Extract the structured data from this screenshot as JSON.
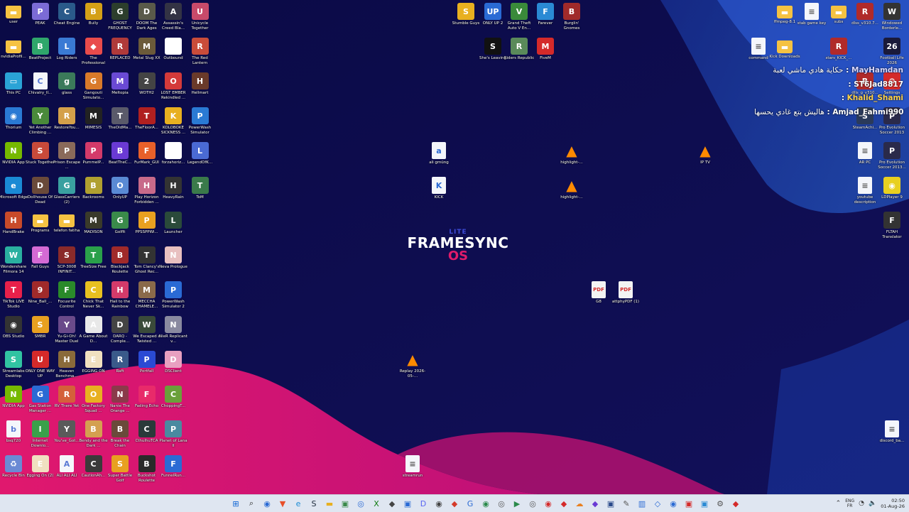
{
  "desktop": {
    "left_icons": [
      {
        "label": "user",
        "glyph": "▬",
        "color": "#f5c242",
        "kind": "folder"
      },
      {
        "label": "PEAK",
        "glyph": "P",
        "color": "#7b6bd6"
      },
      {
        "label": "Cheat Engine",
        "glyph": "C",
        "color": "#2a5a8a"
      },
      {
        "label": "Bully",
        "glyph": "B",
        "color": "#d4a017"
      },
      {
        "label": "GHOST FREQUENCY",
        "glyph": "G",
        "color": "#2c3e2c"
      },
      {
        "label": "DOOM The Dark Ages",
        "glyph": "D",
        "color": "#5a5a4a"
      },
      {
        "label": "Assassin's Creed Bla...",
        "glyph": "A",
        "color": "#333344"
      },
      {
        "label": "Unicycle Together",
        "glyph": "U",
        "color": "#c84a6a"
      },
      {
        "label": "nvidiaProfil...",
        "glyph": "▬",
        "color": "#f5c242",
        "kind": "folder"
      },
      {
        "label": "BeatProject",
        "glyph": "B",
        "color": "#2fa66b"
      },
      {
        "label": "Log Riders",
        "glyph": "L",
        "color": "#3a7ad4"
      },
      {
        "label": "The Professional",
        "glyph": "◆",
        "color": "#e94b4b"
      },
      {
        "label": "REPLACED",
        "glyph": "R",
        "color": "#b03a3a"
      },
      {
        "label": "Metal Slug XX",
        "glyph": "M",
        "color": "#6b5a3a"
      },
      {
        "label": "Outbound",
        "glyph": "O",
        "color": "#ffffff"
      },
      {
        "label": "The Red Lantern",
        "glyph": "R",
        "color": "#c94c3a"
      },
      {
        "label": "This PC",
        "glyph": "▭",
        "color": "#2aa3d6"
      },
      {
        "label": "Chivalry_II...",
        "glyph": "C",
        "color": "#5a7ad4",
        "kind": "doc"
      },
      {
        "label": "glass",
        "glyph": "g",
        "color": "#3b7a5a"
      },
      {
        "label": "Gangouti Simulato...",
        "glyph": "G",
        "color": "#d97a2a"
      },
      {
        "label": "Meltopia",
        "glyph": "M",
        "color": "#6a4ad4"
      },
      {
        "label": "WOTH2",
        "glyph": "2",
        "color": "#444"
      },
      {
        "label": "LOST EMBER Rekindled ...",
        "glyph": "O",
        "color": "#d43a3a"
      },
      {
        "label": "Hellmart",
        "glyph": "H",
        "color": "#6a3a2a"
      },
      {
        "label": "Thorium",
        "glyph": "◉",
        "color": "#2a7ad4"
      },
      {
        "label": "Yet Another Climbing ...",
        "glyph": "Y",
        "color": "#4a8a3a"
      },
      {
        "label": "RestoreYou...",
        "glyph": "R",
        "color": "#d4a04a"
      },
      {
        "label": "MIMESIS",
        "glyph": "M",
        "color": "#222"
      },
      {
        "label": "TheOldMa...",
        "glyph": "T",
        "color": "#5a5a6a"
      },
      {
        "label": "TheFloorA...",
        "glyph": "T",
        "color": "#b02020"
      },
      {
        "label": "KOLOBOKE SICKNESS ...",
        "glyph": "K",
        "color": "#e8b020"
      },
      {
        "label": "PowerWash Simulator",
        "glyph": "P",
        "color": "#2a7ad4"
      },
      {
        "label": "NVIDIA App",
        "glyph": "N",
        "color": "#76b900"
      },
      {
        "label": "Stuck Together",
        "glyph": "S",
        "color": "#c84a3a"
      },
      {
        "label": "Prison Escape ...",
        "glyph": "P",
        "color": "#8a6a5a"
      },
      {
        "label": "PummelP...",
        "glyph": "P",
        "color": "#d43a6a"
      },
      {
        "label": "BeatTheC...",
        "glyph": "B",
        "color": "#6a3ad4"
      },
      {
        "label": "FurMark_GUI",
        "glyph": "F",
        "color": "#e8602a"
      },
      {
        "label": "forzahoriz...",
        "glyph": "F",
        "color": "#ffffff"
      },
      {
        "label": "LegendOfK...",
        "glyph": "L",
        "color": "#4a6ad4"
      },
      {
        "label": "Microsoft Edge",
        "glyph": "e",
        "color": "#1a8ad4"
      },
      {
        "label": "Dollhouse Of Dead",
        "glyph": "D",
        "color": "#6a4a3a"
      },
      {
        "label": "GlassCarriers (2)",
        "glyph": "G",
        "color": "#3aa0a0"
      },
      {
        "label": "Backrooms",
        "glyph": "B",
        "color": "#b0a030"
      },
      {
        "label": "OnlyUP",
        "glyph": "O",
        "color": "#5a8ad4"
      },
      {
        "label": "Play Horizon Forbidden ...",
        "glyph": "H",
        "color": "#c86a8a"
      },
      {
        "label": "HeavyRain",
        "glyph": "H",
        "color": "#333"
      },
      {
        "label": "ToM",
        "glyph": "T",
        "color": "#3a7a4a"
      },
      {
        "label": "HandBrake",
        "glyph": "H",
        "color": "#c84a2a"
      },
      {
        "label": "Programs",
        "glyph": "▬",
        "color": "#f5c242",
        "kind": "folder"
      },
      {
        "label": "telefon fatiha",
        "glyph": "▬",
        "color": "#f5c242",
        "kind": "folder"
      },
      {
        "label": "MADISON",
        "glyph": "M",
        "color": "#3a3a2a"
      },
      {
        "label": "GolfIt",
        "glyph": "G",
        "color": "#3a8a4a"
      },
      {
        "label": "PPSSPPWi...",
        "glyph": "P",
        "color": "#e8a020"
      },
      {
        "label": "Launcher",
        "glyph": "L",
        "color": "#2a4a3a"
      },
      {
        "label": "Wondershare Filmora 14",
        "glyph": "W",
        "color": "#2ab0a0"
      },
      {
        "label": "Fall Guys",
        "glyph": "F",
        "color": "#d46ad4"
      },
      {
        "label": "SCP-3008 INFINIT...",
        "glyph": "S",
        "color": "#8a2a2a"
      },
      {
        "label": "TreeSize Free",
        "glyph": "T",
        "color": "#2aa04a"
      },
      {
        "label": "Blackjack Roulette",
        "glyph": "B",
        "color": "#a02a2a"
      },
      {
        "label": "Tom Clancy's Ghost Rec...",
        "glyph": "T",
        "color": "#333"
      },
      {
        "label": "Neva Prologue",
        "glyph": "N",
        "color": "#e8c0c0"
      },
      {
        "label": "TikTok LIVE Studio",
        "glyph": "T",
        "color": "#e8204a"
      },
      {
        "label": "Nine_Ball_...",
        "glyph": "9",
        "color": "#a02a2a"
      },
      {
        "label": "Focusrite Control",
        "glyph": "F",
        "color": "#2a8a2a"
      },
      {
        "label": "Chick That Never Sk...",
        "glyph": "C",
        "color": "#e8c020"
      },
      {
        "label": "Hail to the Rainbow",
        "glyph": "H",
        "color": "#d43a6a"
      },
      {
        "label": "MECCHA CHAMELE...",
        "glyph": "M",
        "color": "#8a6a4a"
      },
      {
        "label": "PowerWash Simulator 2",
        "glyph": "P",
        "color": "#2a6ad4"
      },
      {
        "label": "OBS Studio",
        "glyph": "◉",
        "color": "#333"
      },
      {
        "label": "SMBR",
        "glyph": "S",
        "color": "#e8a020"
      },
      {
        "label": "Yu-Gi-Oh! Master Duel",
        "glyph": "Y",
        "color": "#6a4a8a"
      },
      {
        "label": "A Game About D...",
        "glyph": "A",
        "color": "#e8e8e8"
      },
      {
        "label": "DARQ - Comple...",
        "glyph": "D",
        "color": "#444"
      },
      {
        "label": "We Escaped a Twisted ...",
        "glyph": "W",
        "color": "#3a4a3a"
      },
      {
        "label": "NieR Replicant v...",
        "glyph": "N",
        "color": "#8a8aa0"
      },
      {
        "label": "Streamlabs Desktop",
        "glyph": "S",
        "color": "#31c3a2"
      },
      {
        "label": "ONLY ONE WAY UP",
        "glyph": "U",
        "color": "#d42a2a"
      },
      {
        "label": "Heaven Benchma...",
        "glyph": "H",
        "color": "#8a6a3a"
      },
      {
        "label": "EGGING ON",
        "glyph": "E",
        "color": "#f0e0c0"
      },
      {
        "label": "Raft",
        "glyph": "R",
        "color": "#3a5a8a"
      },
      {
        "label": "Portfall",
        "glyph": "P",
        "color": "#2a4ad4"
      },
      {
        "label": "DSClient",
        "glyph": "D",
        "color": "#e8a0c0"
      },
      {
        "label": "NVIDIA App",
        "glyph": "N",
        "color": "#76b900"
      },
      {
        "label": "Gas Station Manager ...",
        "glyph": "G",
        "color": "#2a6ad4"
      },
      {
        "label": "RV There Yet",
        "glyph": "R",
        "color": "#d4603a"
      },
      {
        "label": "One Factory Squad ...",
        "glyph": "O",
        "color": "#e8b020"
      },
      {
        "label": "Nanie The Orange ...",
        "glyph": "N",
        "color": "#8a3a4a"
      },
      {
        "label": "Fading Echo",
        "glyph": "F",
        "color": "#e82a6a"
      },
      {
        "label": "ChoppingT...",
        "glyph": "C",
        "color": "#6aa03a"
      },
      {
        "label": "bsq720",
        "glyph": "b",
        "color": "#5a7ad4",
        "kind": "doc"
      },
      {
        "label": "Internet Downlo...",
        "glyph": "I",
        "color": "#3aa04a"
      },
      {
        "label": "You've_Got...",
        "glyph": "Y",
        "color": "#5a5a5a"
      },
      {
        "label": "Bendy and the Dark ...",
        "glyph": "B",
        "color": "#d4a050"
      },
      {
        "label": "Break the Chain",
        "glyph": "B",
        "color": "#6a4a3a"
      },
      {
        "label": "CthulhuTCA",
        "glyph": "C",
        "color": "#2a3a3a"
      },
      {
        "label": "Planet of Lana II",
        "glyph": "P",
        "color": "#4a8aa0"
      },
      {
        "label": "Recycle Bin",
        "glyph": "♻",
        "color": "#6a8ad4"
      },
      {
        "label": "Egging On (2)",
        "glyph": "E",
        "color": "#f0e0c0"
      },
      {
        "label": "ALI ALI ALI",
        "glyph": "A",
        "color": "#5a7ad4",
        "kind": "doc"
      },
      {
        "label": "CautionAh...",
        "glyph": "C",
        "color": "#3a3a3a"
      },
      {
        "label": "Super Battle Golf",
        "glyph": "S",
        "color": "#e8a020"
      },
      {
        "label": "Buckshot Roulette",
        "glyph": "B",
        "color": "#2a2a2a"
      },
      {
        "label": "FunnelRun...",
        "glyph": "F",
        "color": "#2a6ad4"
      }
    ],
    "middle_icons": [
      {
        "label": "Stumble Guys",
        "glyph": "S",
        "color": "#e8b020"
      },
      {
        "label": "ONLY UP 2",
        "glyph": "UP",
        "color": "#2a6ad4"
      },
      {
        "label": "Grand Theft Auto V En...",
        "glyph": "V",
        "color": "#3a8a3a"
      },
      {
        "label": "Farever",
        "glyph": "F",
        "color": "#2a8ad4"
      },
      {
        "label": "Burglin' Gnomes",
        "glyph": "B",
        "color": "#a02a2a"
      },
      {
        "label": "She's Leaving",
        "glyph": "S",
        "color": "#111"
      },
      {
        "label": "Riders Republic",
        "glyph": "R",
        "color": "#5a8a5a"
      },
      {
        "label": "FiveM",
        "glyph": "M",
        "color": "#d42a2a"
      },
      {
        "label": "ali gmüng",
        "glyph": "a",
        "color": "#2a6ad4",
        "kind": "doc"
      },
      {
        "label": "highlight-...",
        "glyph": "▲",
        "color": "#ff8a00",
        "kind": "cone"
      },
      {
        "label": "IP TV",
        "glyph": "▲",
        "color": "#ff8a00",
        "kind": "cone"
      },
      {
        "label": "KICK",
        "glyph": "K",
        "color": "#2a6ad4",
        "kind": "doc"
      },
      {
        "label": "highlight-...",
        "glyph": "▲",
        "color": "#ff8a00",
        "kind": "cone"
      },
      {
        "label": "G8",
        "glyph": "PDF",
        "color": "#d42a2a",
        "kind": "pdf"
      },
      {
        "label": "attphyPDF (1)",
        "glyph": "PDF",
        "color": "#d42a2a",
        "kind": "pdf"
      },
      {
        "label": "Replay 2026-05-...",
        "glyph": "▲",
        "color": "#ff8a00",
        "kind": "cone"
      },
      {
        "label": "streamrun",
        "glyph": "≡",
        "color": "#555",
        "kind": "doc"
      }
    ],
    "right_icons": [
      {
        "label": "ffmpeg-8.1",
        "glyph": "▬",
        "color": "#f5c242",
        "kind": "folder"
      },
      {
        "label": "stab game key",
        "glyph": "≡",
        "color": "#555",
        "kind": "doc"
      },
      {
        "label": "subs",
        "glyph": "▬",
        "color": "#f5c242",
        "kind": "folder"
      },
      {
        "label": "dlss_v310.7...",
        "glyph": "R",
        "color": "#b02a2a"
      },
      {
        "label": "Windowed Borderle...",
        "glyph": "W",
        "color": "#333"
      },
      {
        "label": "command",
        "glyph": "≡",
        "color": "#555",
        "kind": "doc"
      },
      {
        "label": "Kick Downloads",
        "glyph": "▬",
        "color": "#f5c242",
        "kind": "folder"
      },
      {
        "label": "stars_KICK_...",
        "glyph": "R",
        "color": "#b02a2a"
      },
      {
        "label": "Football Life 2026",
        "glyph": "26",
        "color": "#1a1a3a"
      },
      {
        "label": "dlls_g_v310...",
        "glyph": "R",
        "color": "#b02a2a"
      },
      {
        "label": "Settings",
        "glyph": "⚙",
        "color": "#d42a2a"
      },
      {
        "label": "SteamAchi...",
        "glyph": "S",
        "color": "#2a3a5a"
      },
      {
        "label": "Pro Evolution Soccer 2013",
        "glyph": "P",
        "color": "#2a2a4a"
      },
      {
        "label": "AR PC",
        "glyph": "≡",
        "color": "#555",
        "kind": "doc"
      },
      {
        "label": "Pro Evolution Soccer 2013...",
        "glyph": "P",
        "color": "#2a2a4a"
      },
      {
        "label": "youtube description",
        "glyph": "≡",
        "color": "#555",
        "kind": "doc"
      },
      {
        "label": "LDPlayer 9",
        "glyph": "◉",
        "color": "#e8d020"
      },
      {
        "label": "FLTAH Translator",
        "glyph": "F",
        "color": "#333"
      },
      {
        "label": "discord_ba...",
        "glyph": "≡",
        "color": "#555",
        "kind": "doc"
      }
    ],
    "logo": {
      "lite": "LITE",
      "name": "FRAMESYNC",
      "os": "OS"
    },
    "chat": [
      {
        "user": "MayHamdan",
        "message": "حكاية هادي ماشي لعبة",
        "user_color": "#d8d8ff"
      },
      {
        "user": "ST6Jad8817",
        "message": "",
        "user_color": "#ffffff"
      },
      {
        "user": "Khalid_Shami",
        "message": "",
        "user_color": "#ffd24a"
      },
      {
        "user": "Amjad_Fahmi990",
        "message": "هاليش بتع غادي يحسها",
        "user_color": "#ffffff"
      }
    ]
  },
  "taskbar": {
    "apps": [
      {
        "name": "start-icon",
        "glyph": "⊞",
        "color": "#0a62d4"
      },
      {
        "name": "search-icon",
        "glyph": "⌕",
        "color": "#222"
      },
      {
        "name": "thorium-icon",
        "glyph": "◉",
        "color": "#2a6ad4"
      },
      {
        "name": "brave-icon",
        "glyph": "▼",
        "color": "#e8502a"
      },
      {
        "name": "edge-icon",
        "glyph": "e",
        "color": "#1a8ad4"
      },
      {
        "name": "steam-icon",
        "glyph": "S",
        "color": "#1b2838"
      },
      {
        "name": "explorer-icon",
        "glyph": "▬",
        "color": "#e8b020"
      },
      {
        "name": "app-icon",
        "glyph": "▣",
        "color": "#3a8a4a"
      },
      {
        "name": "app-icon",
        "glyph": "◎",
        "color": "#2a6ad4"
      },
      {
        "name": "xbox-icon",
        "glyph": "X",
        "color": "#107c10"
      },
      {
        "name": "app-icon",
        "glyph": "◆",
        "color": "#444"
      },
      {
        "name": "app-icon",
        "glyph": "▣",
        "color": "#2a6ad4"
      },
      {
        "name": "discord-icon",
        "glyph": "D",
        "color": "#5865f2"
      },
      {
        "name": "app-icon",
        "glyph": "◉",
        "color": "#444"
      },
      {
        "name": "app-icon",
        "glyph": "◆",
        "color": "#d43a2a"
      },
      {
        "name": "app-icon",
        "glyph": "G",
        "color": "#2a6ad4"
      },
      {
        "name": "chrome-icon",
        "glyph": "◉",
        "color": "#2a8a4a"
      },
      {
        "name": "app-icon",
        "glyph": "◎",
        "color": "#555"
      },
      {
        "name": "app-icon",
        "glyph": "▶",
        "color": "#2a8a4a"
      },
      {
        "name": "app-icon",
        "glyph": "◎",
        "color": "#555"
      },
      {
        "name": "app-icon",
        "glyph": "◉",
        "color": "#d42a2a"
      },
      {
        "name": "app-icon",
        "glyph": "◆",
        "color": "#d42a2a"
      },
      {
        "name": "app-icon",
        "glyph": "☁",
        "color": "#e88020"
      },
      {
        "name": "app-icon",
        "glyph": "◆",
        "color": "#6a3ad4"
      },
      {
        "name": "app-icon",
        "glyph": "▣",
        "color": "#2a4a8a"
      },
      {
        "name": "app-icon",
        "glyph": "✎",
        "color": "#555"
      },
      {
        "name": "app-icon",
        "glyph": "▥",
        "color": "#2a6ad4"
      },
      {
        "name": "app-icon",
        "glyph": "◇",
        "color": "#2a6ad4"
      },
      {
        "name": "app-icon",
        "glyph": "◉",
        "color": "#2a6ad4"
      },
      {
        "name": "app-icon",
        "glyph": "▣",
        "color": "#d42a2a"
      },
      {
        "name": "app-icon",
        "glyph": "▣",
        "color": "#2a8ad4"
      },
      {
        "name": "app-icon",
        "glyph": "⚙",
        "color": "#555"
      },
      {
        "name": "app-icon",
        "glyph": "◆",
        "color": "#d42a2a"
      }
    ],
    "tray": {
      "lang_top": "ENG",
      "lang_bottom": "FR",
      "time": "02:50",
      "date": "01-Aug-26"
    }
  }
}
